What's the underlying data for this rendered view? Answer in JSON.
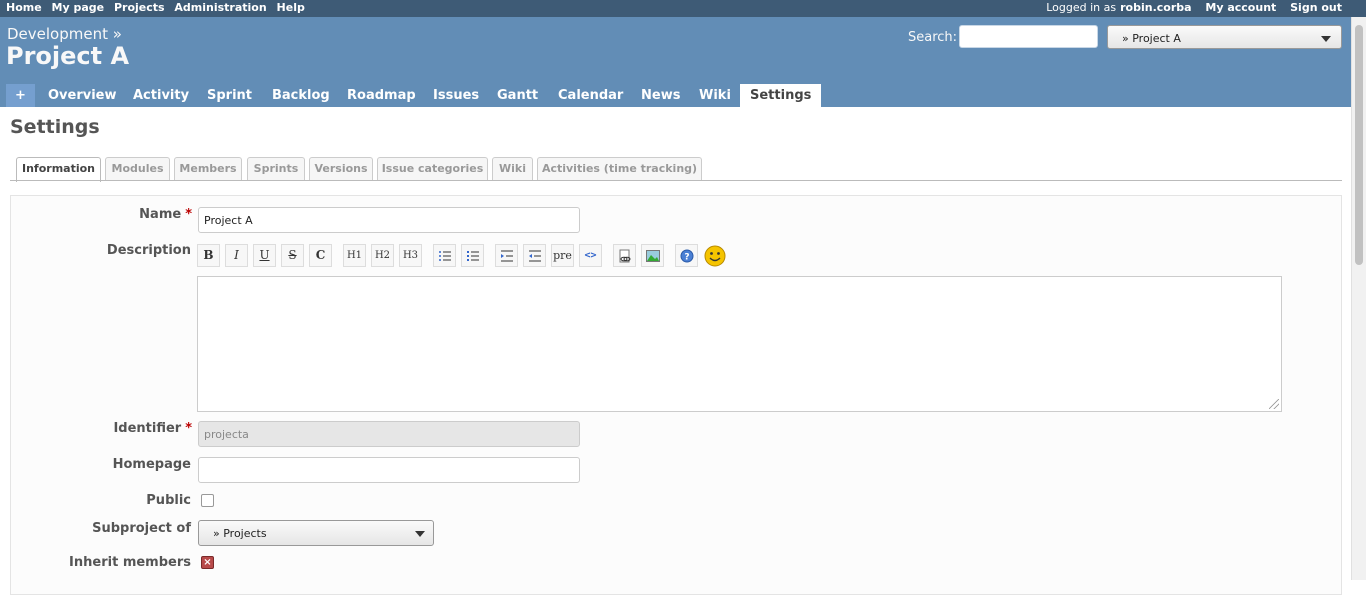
{
  "top_menu": {
    "left": [
      "Home",
      "My page",
      "Projects",
      "Administration",
      "Help"
    ],
    "logged_in_prefix": "Logged in as",
    "user": "robin.corba",
    "my_account": "My account",
    "sign_out": "Sign out"
  },
  "header": {
    "parent": "Development »",
    "title": "Project A",
    "search_label": "Search:",
    "jump_value": "» Project A"
  },
  "main_menu": {
    "plus": "+",
    "tabs": [
      "Overview",
      "Activity",
      "Sprint",
      "Backlog",
      "Roadmap",
      "Issues",
      "Gantt",
      "Calendar",
      "News",
      "Wiki",
      "Settings"
    ],
    "selected": "Settings"
  },
  "page_title": "Settings",
  "settings_tabs": [
    "Information",
    "Modules",
    "Members",
    "Sprints",
    "Versions",
    "Issue categories",
    "Wiki",
    "Activities (time tracking)"
  ],
  "active_settings_tab": "Information",
  "form": {
    "name_label": "Name",
    "name_value": "Project A",
    "required_mark": "*",
    "description_label": "Description",
    "toolbar": [
      "B",
      "I",
      "U",
      "S",
      "C",
      "H1",
      "H2",
      "H3",
      "ul",
      "ol",
      "indent",
      "outdent",
      "pre",
      "<>",
      "link",
      "img",
      "?",
      "smiley"
    ],
    "identifier_label": "Identifier",
    "identifier_value": "projecta",
    "homepage_label": "Homepage",
    "homepage_value": "",
    "public_label": "Public",
    "subproject_label": "Subproject of",
    "subproject_value": "» Projects",
    "inherit_label": "Inherit members"
  }
}
